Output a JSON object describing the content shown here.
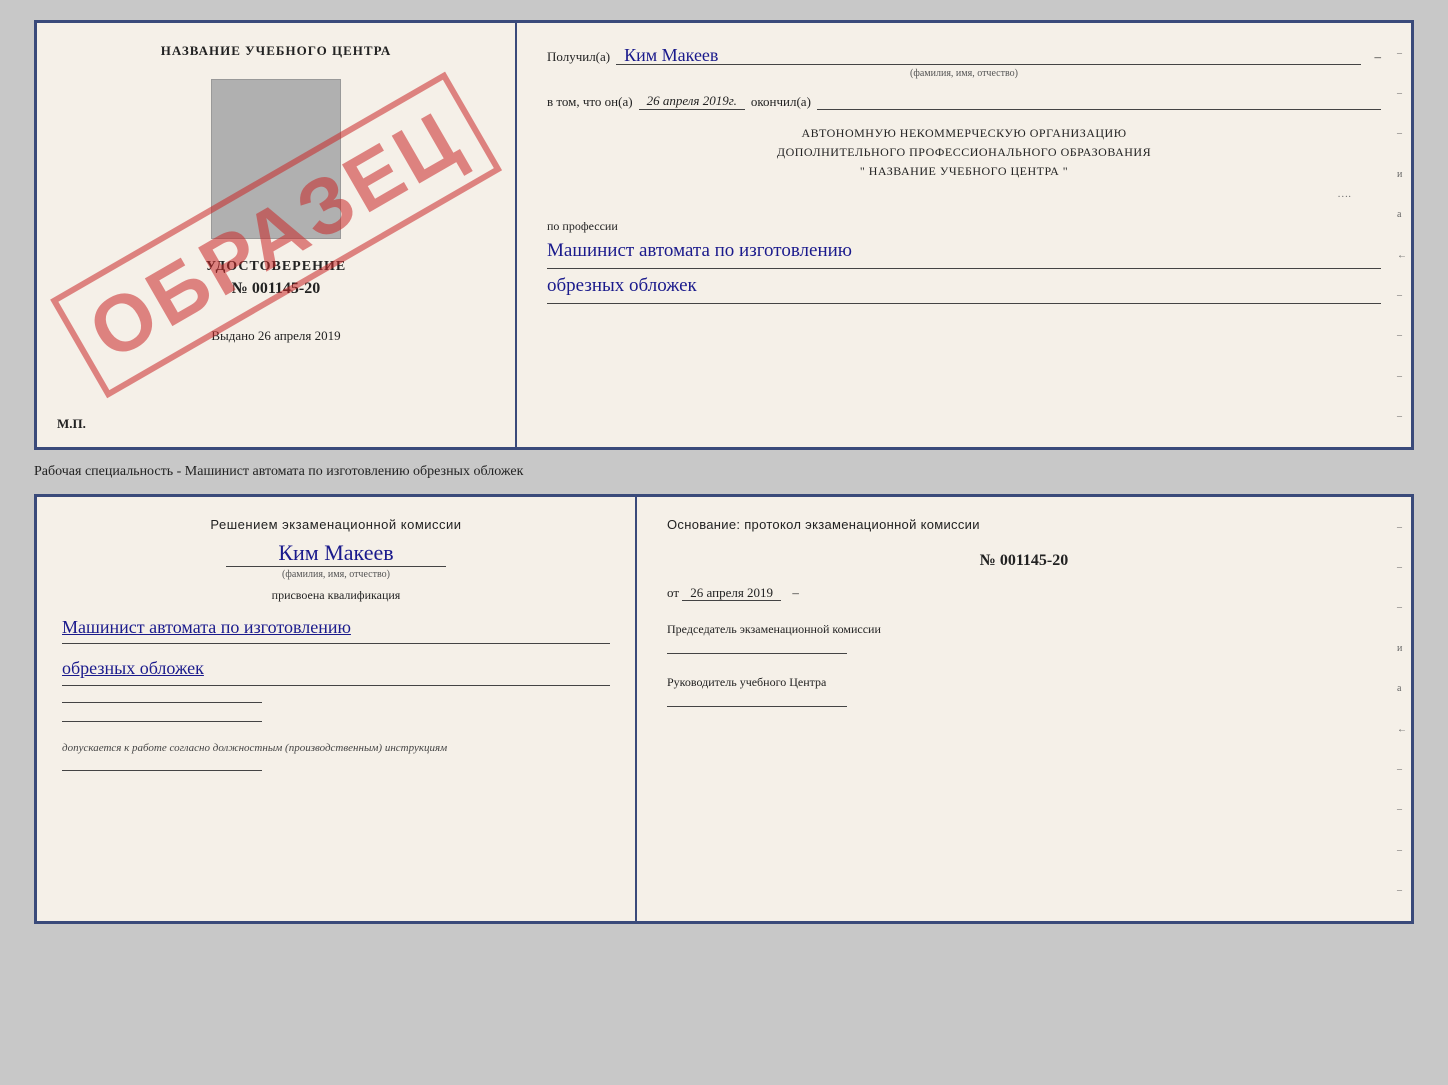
{
  "top_doc": {
    "left": {
      "title": "НАЗВАНИЕ УЧЕБНОГО ЦЕНТРА",
      "cert_title": "УДОСТОВЕРЕНИЕ",
      "cert_number": "№ 001145-20",
      "issued_label": "Выдано",
      "issued_date": "26 апреля 2019",
      "mp_label": "М.П.",
      "obrazec": "ОБРАЗЕЦ"
    },
    "right": {
      "received_label": "Получил(а)",
      "received_name": "Ким Макеев",
      "name_subtext": "(фамилия, имя, отчество)",
      "in_that_label": "в том, что он(а)",
      "date_value": "26 апреля 2019г.",
      "finished_label": "окончил(а)",
      "org_line1": "АВТОНОМНУЮ НЕКОММЕРЧЕСКУЮ ОРГАНИЗАЦИЮ",
      "org_line2": "ДОПОЛНИТЕЛЬНОГО ПРОФЕССИОНАЛЬНОГО ОБРАЗОВАНИЯ",
      "org_line3": "\"    НАЗВАНИЕ УЧЕБНОГО ЦЕНТРА    \"",
      "profession_label": "по профессии",
      "profession_line1": "Машинист автомата по изготовлению",
      "profession_line2": "обрезных обложек"
    }
  },
  "separator": {
    "text": "Рабочая специальность - Машинист автомата по изготовлению обрезных обложек"
  },
  "bottom_doc": {
    "left": {
      "komissia_title": "Решением экзаменационной комиссии",
      "name": "Ким Макеев",
      "name_subtext": "(фамилия, имя, отчество)",
      "assigned_text": "присвоена квалификация",
      "qualification_line1": "Машинист автомата по изготовлению",
      "qualification_line2": "обрезных обложек",
      "допускается_text": "допускается к  работе согласно должностным (производственным) инструкциям"
    },
    "right": {
      "basis_label": "Основание: протокол экзаменационной комиссии",
      "protocol_number": "№  001145-20",
      "protocol_date_prefix": "от",
      "protocol_date": "26 апреля 2019",
      "chairman_label": "Председатель экзаменационной комиссии",
      "руководитель_label": "Руководитель учебного Центра"
    }
  },
  "edge_marks": {
    "top_right": [
      "-",
      "-",
      "-",
      "и",
      "а",
      "←",
      "-",
      "-",
      "-",
      "-"
    ],
    "bottom_right": [
      "-",
      "-",
      "-",
      "и",
      "а",
      "←",
      "-",
      "-",
      "-",
      "-"
    ]
  }
}
